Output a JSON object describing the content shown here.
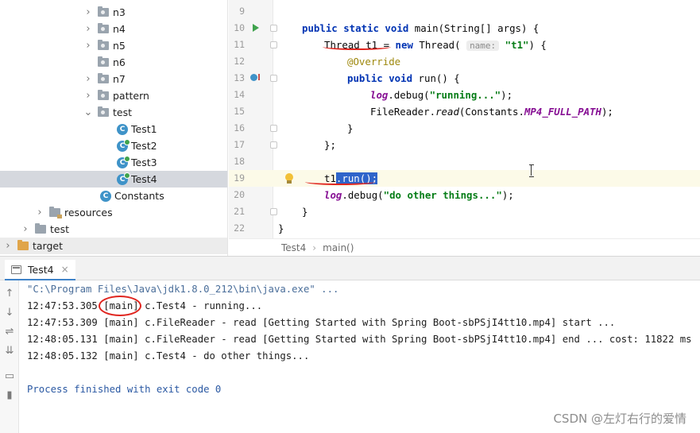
{
  "tree": {
    "items": [
      {
        "label": "n3",
        "kind": "package",
        "arrow": "›"
      },
      {
        "label": "n4",
        "kind": "package",
        "arrow": "›"
      },
      {
        "label": "n5",
        "kind": "package",
        "arrow": "›"
      },
      {
        "label": "n6",
        "kind": "package",
        "arrow": ""
      },
      {
        "label": "n7",
        "kind": "package",
        "arrow": "›"
      },
      {
        "label": "pattern",
        "kind": "package",
        "arrow": "›"
      },
      {
        "label": "test",
        "kind": "package",
        "arrow": "⌄"
      },
      {
        "label": "Test1",
        "kind": "class"
      },
      {
        "label": "Test2",
        "kind": "class"
      },
      {
        "label": "Test3",
        "kind": "class"
      },
      {
        "label": "Test4",
        "kind": "class"
      },
      {
        "label": "Constants",
        "kind": "class"
      },
      {
        "label": "resources",
        "kind": "folder",
        "arrow": "›"
      },
      {
        "label": "test",
        "kind": "folder",
        "arrow": "›"
      },
      {
        "label": "target",
        "kind": "folder",
        "arrow": "›"
      }
    ],
    "class_icon_letter": "C"
  },
  "editor": {
    "line_numbers": [
      "9",
      "10",
      "11",
      "12",
      "13",
      "14",
      "15",
      "16",
      "17",
      "18",
      "19",
      "20",
      "21",
      "22"
    ],
    "code": {
      "l10_kw1": "public static void",
      "l10_rest": " main(String[] args) {",
      "l11_type": "Thread t1 = ",
      "l11_new": "new",
      "l11_cls": " Thread( ",
      "l11_hint": "name:",
      "l11_str": "\"t1\"",
      "l11_end": ") {",
      "l12_ann": "@Override",
      "l13_kw": "public void",
      "l13_rest": " run() {",
      "l14_log": "log",
      "l14_mid": ".debug(",
      "l14_str": "\"running...\"",
      "l14_end": ");",
      "l15_a": "FileReader.",
      "l15_read": "read",
      "l15_b": "(Constants.",
      "l15_fld": "MP4_FULL_PATH",
      "l15_end": ");",
      "l16": "}",
      "l17": "};",
      "l19_t1": "t1",
      "l19_sel": ".run();",
      "l20_log": "log",
      "l20_mid": ".debug(",
      "l20_str": "\"do other things...\"",
      "l20_end": ");",
      "l21": "}",
      "l22": "}"
    },
    "breadcrumb": [
      "Test4",
      "main()"
    ],
    "breadcrumb_sep": "›"
  },
  "run_panel": {
    "tab_label": "Test4",
    "tab_close": "×",
    "toolbar_icons": [
      "arrow-up-icon",
      "arrow-down-icon",
      "soft-wrap-icon",
      "scroll-to-end-icon",
      "print-icon",
      "trash-icon"
    ],
    "toolbar_glyphs": [
      "↑",
      "↓",
      "⇌",
      "⇊",
      "▭",
      "▮"
    ],
    "console": [
      "\"C:\\Program Files\\Java\\jdk1.8.0_212\\bin\\java.exe\" ...",
      "12:47:53.305 [main] c.Test4 - running...",
      "12:47:53.309 [main] c.FileReader - read [Getting Started with Spring Boot-sbPSjI4tt10.mp4] start ...",
      "12:48:05.131 [main] c.FileReader - read [Getting Started with Spring Boot-sbPSjI4tt10.mp4] end ... cost: 11822 ms",
      "12:48:05.132 [main] c.Test4 - do other things...",
      "",
      "Process finished with exit code 0"
    ]
  },
  "watermark": "CSDN @左灯右行的爱情",
  "colors": {
    "keyword": "#0033b3",
    "string": "#067d17",
    "annotation": "#9e880d",
    "selection": "#2f65ca",
    "mark": "#e0251f"
  }
}
